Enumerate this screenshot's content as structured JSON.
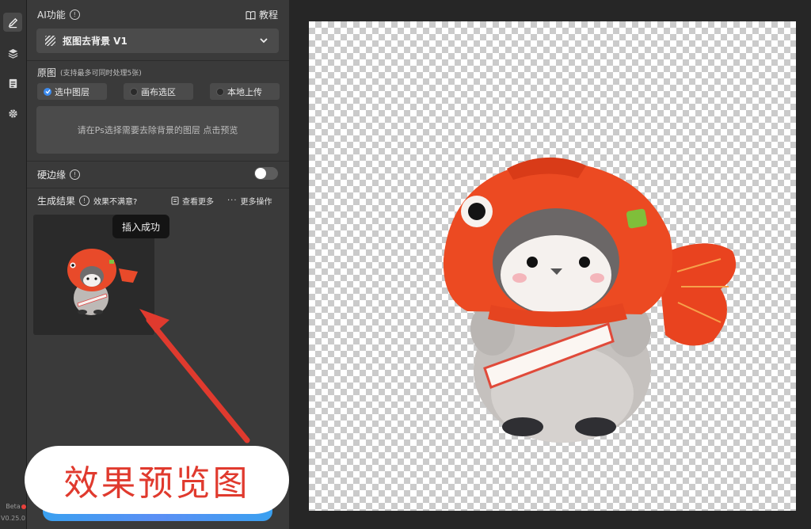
{
  "sidebar": {
    "icons": [
      "brush-icon",
      "layers-icon",
      "document-icon",
      "settings-icon"
    ],
    "beta_label": "Beta",
    "version": "V0.25.0"
  },
  "panel": {
    "ai_title": "AI功能",
    "tutorial_label": "教程",
    "feature_select": {
      "value": "抠图去背景 V1"
    },
    "source": {
      "title": "原图",
      "subtitle": "(支持最多可同时处理5张)",
      "options": [
        {
          "label": "选中图层",
          "selected": true
        },
        {
          "label": "画布选区",
          "selected": false
        },
        {
          "label": "本地上传",
          "selected": false
        }
      ],
      "hint": "请在Ps选择需要去除背景的图层 点击预览"
    },
    "hard_edge": {
      "label": "硬边缘",
      "enabled": false
    },
    "results": {
      "title": "生成结果",
      "not_satisfied": "效果不满意?",
      "view_more": "查看更多",
      "more_actions": "更多操作",
      "toast": "插入成功"
    }
  },
  "annotation": {
    "caption": "效果预览图"
  },
  "colors": {
    "accent": "#3d8cf0",
    "annotation_red": "#e03a2e",
    "panel_bg": "#3a3a3a",
    "workspace_bg": "#262626"
  }
}
